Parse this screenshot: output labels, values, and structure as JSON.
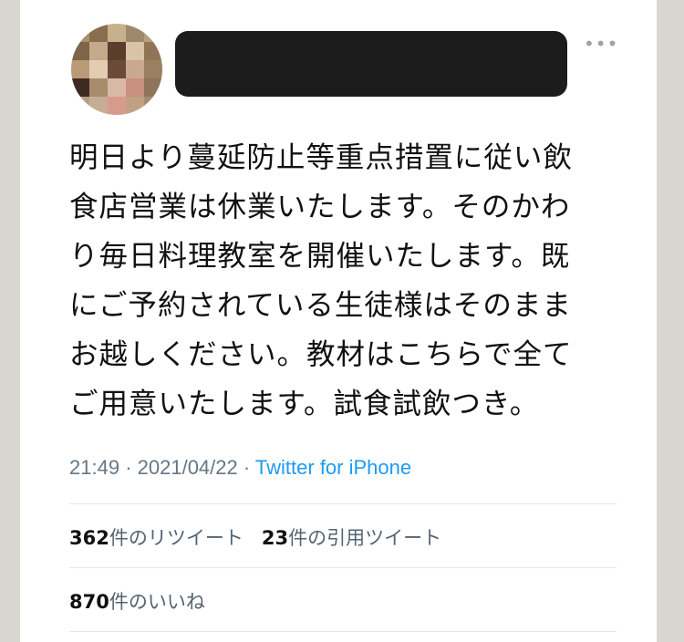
{
  "tweet": {
    "lines": [
      "明日より蔓延防止等重点措置に従い飲",
      "食店営業は休業いたします。そのかわ",
      "り毎日料理教室を開催いたします。既",
      "にご予約されている生徒様はそのまま",
      "お越しください。教材はこちらで全て",
      "ご用意いたします。試食試飲つき。"
    ],
    "time": "21:49",
    "date": "2021/04/22",
    "separator": "·",
    "source": "Twitter for iPhone"
  },
  "stats": {
    "retweets_count": "362",
    "retweets_label": "件のリツイート",
    "quotes_count": "23",
    "quotes_label": "件の引用ツイート",
    "likes_count": "870",
    "likes_label": "件のいいね"
  },
  "colors": {
    "text": "#111111",
    "meta": "#657786",
    "link": "#1d9bf0",
    "divider": "#e1e8ed",
    "background": "#d9d6cf"
  },
  "icons": {
    "more": "more-horizontal-icon"
  }
}
